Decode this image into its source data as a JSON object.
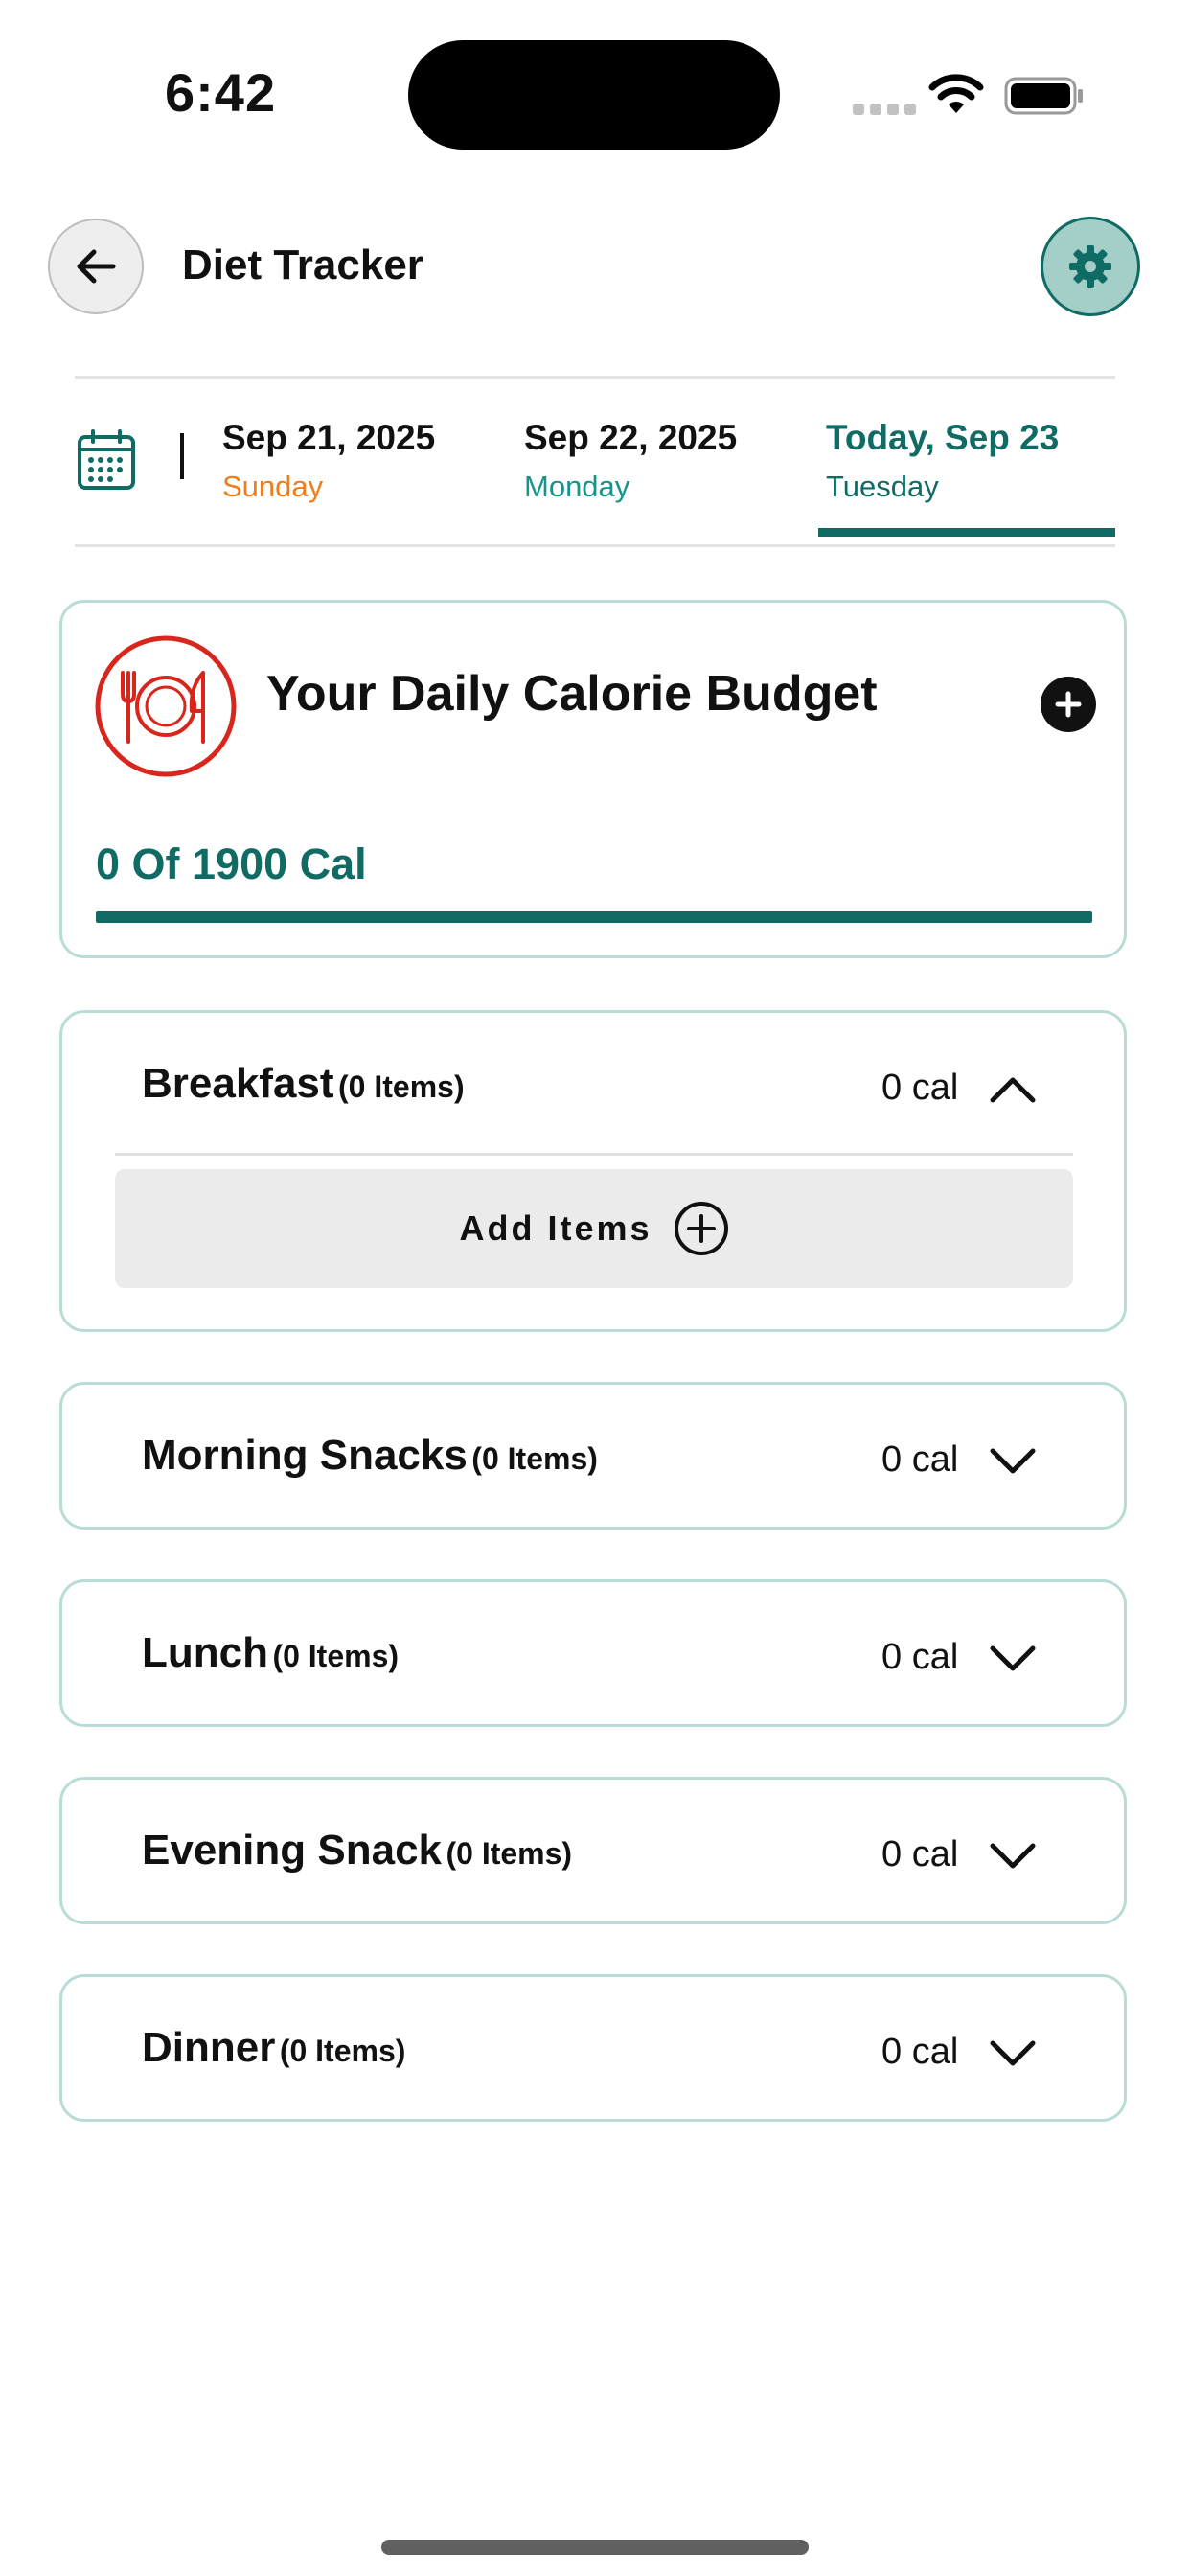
{
  "status_bar": {
    "time": "6:42"
  },
  "header": {
    "title": "Diet Tracker",
    "back_icon": "arrow-left-icon",
    "settings_icon": "gear-icon"
  },
  "date_tabs": [
    {
      "date": "Sep 21, 2025",
      "day": "Sunday",
      "day_color": "#f07c1a"
    },
    {
      "date": "Sep 22, 2025",
      "day": "Monday",
      "day_color": "#17948a"
    },
    {
      "date": "Today, Sep 23",
      "day": "Tuesday",
      "selected": true,
      "accent": "#0f6b63"
    }
  ],
  "calorie_budget": {
    "title": "Your Daily Calorie Budget",
    "summary": "0 Of 1900 Cal",
    "consumed": 0,
    "budget": 1900,
    "icon": "plate-icon",
    "accent": "#0f6b63"
  },
  "meals": [
    {
      "name": "Breakfast",
      "count": "(0 Items)",
      "calories": "0 cal",
      "expanded": true,
      "add_label": "Add Items"
    },
    {
      "name": "Morning Snacks",
      "count": "(0 Items)",
      "calories": "0 cal",
      "expanded": false
    },
    {
      "name": "Lunch",
      "count": "(0 Items)",
      "calories": "0 cal",
      "expanded": false
    },
    {
      "name": "Evening Snack",
      "count": "(0 Items)",
      "calories": "0 cal",
      "expanded": false
    },
    {
      "name": "Dinner",
      "count": "(0 Items)",
      "calories": "0 cal",
      "expanded": false
    }
  ]
}
